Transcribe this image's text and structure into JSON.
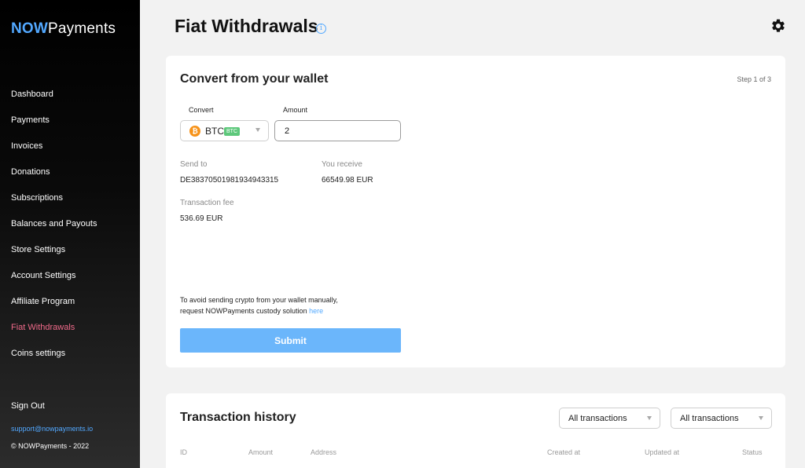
{
  "brand": {
    "part1": "NOW",
    "part2": "Payments"
  },
  "sidebar": {
    "items": [
      {
        "label": "Dashboard"
      },
      {
        "label": "Payments"
      },
      {
        "label": "Invoices"
      },
      {
        "label": "Donations"
      },
      {
        "label": "Subscriptions"
      },
      {
        "label": "Balances and Payouts"
      },
      {
        "label": "Store Settings"
      },
      {
        "label": "Account Settings"
      },
      {
        "label": "Affiliate Program"
      },
      {
        "label": "Fiat Withdrawals"
      },
      {
        "label": "Coins settings"
      }
    ],
    "active_index": 9,
    "sign_out": "Sign Out",
    "support_email": "support@nowpayments.io",
    "copyright": "© NOWPayments - 2022"
  },
  "header": {
    "title": "Fiat Withdrawals",
    "info_glyph": "i"
  },
  "convert": {
    "title": "Convert from your wallet",
    "step": "Step 1 of 3",
    "convert_label": "Convert",
    "currency": "BTC",
    "currency_badge": "BTC",
    "currency_icon_glyph": "₿",
    "amount_label": "Amount",
    "amount_value": "2",
    "send_to_label": "Send to",
    "send_to_value": "DE38370501981934943315",
    "receive_label": "You receive",
    "receive_value": "66549.98 EUR",
    "fee_label": "Transaction fee",
    "fee_value": "536.69 EUR",
    "note_line1": "To avoid sending crypto from your wallet manually,",
    "note_line2": "request NOWPayments custody solution ",
    "note_link": "here",
    "submit": "Submit"
  },
  "history": {
    "title": "Transaction history",
    "filter1": "All transactions",
    "filter2": "All transactions",
    "columns": [
      "ID",
      "Amount",
      "Address",
      "Created at",
      "Updated at",
      "Status"
    ]
  },
  "colors": {
    "accent": "#52a8ff",
    "active_nav": "#f06a8a",
    "submit": "#6bb6fb",
    "btc": "#f7931a",
    "badge": "#5dc87b"
  }
}
